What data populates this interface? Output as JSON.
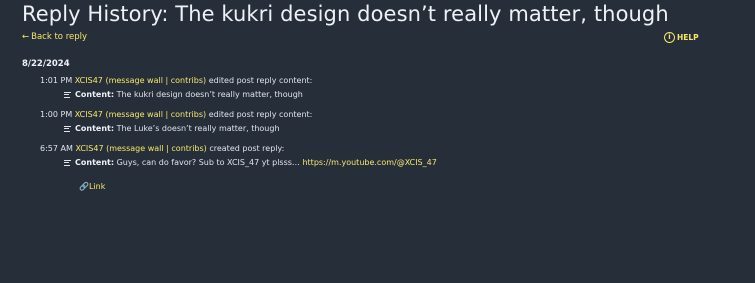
{
  "page": {
    "title": "Reply History: The kukri design doesn’t really matter, though",
    "back_label": "Back to reply",
    "help_label": "HELP",
    "date": "8/22/2024",
    "footer_link": "Link"
  },
  "entries": [
    {
      "time": "1:01 PM",
      "user": "XCIS47",
      "wall": "message wall",
      "contribs": "contribs",
      "action": "edited post reply content:",
      "label": "Content",
      "text": "The kukri design doesn’t really matter, though",
      "url": ""
    },
    {
      "time": "1:00 PM",
      "user": "XCIS47",
      "wall": "message wall",
      "contribs": "contribs",
      "action": "edited post reply content:",
      "label": "Content",
      "text": "The Luke’s doesn’t really matter, though",
      "url": ""
    },
    {
      "time": "6:57 AM",
      "user": "XCIS47",
      "wall": "message wall",
      "contribs": "contribs",
      "action": "created post reply:",
      "label": "Content",
      "text": "Guys, can do favor? Sub to XCIS_47 yt plsss…",
      "url": "https://m.youtube.com/@XCIS_47"
    }
  ]
}
